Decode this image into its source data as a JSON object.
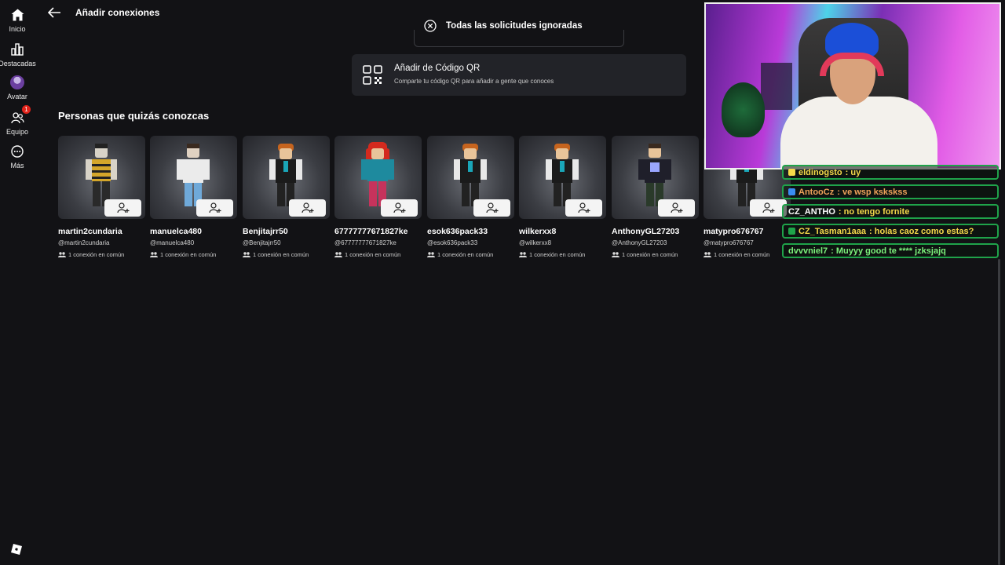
{
  "sidebar": {
    "items": [
      {
        "label": "Inicio",
        "icon": "home-icon"
      },
      {
        "label": "Destacadas",
        "icon": "charts-icon"
      },
      {
        "label": "Avatar",
        "icon": "avatar-icon"
      },
      {
        "label": "Equipo",
        "icon": "team-icon",
        "badge": "1"
      },
      {
        "label": "Más",
        "icon": "more-icon"
      }
    ]
  },
  "header": {
    "title": "Añadir conexiones"
  },
  "toast": {
    "text": "Todas las solicitudes ignoradas"
  },
  "qr": {
    "title": "Añadir de Código QR",
    "subtitle": "Comparte tu código QR para añadir a gente que conoces"
  },
  "section": {
    "title": "Personas que quizás conozcas"
  },
  "people": [
    {
      "name": "martin2cundaria",
      "handle": "@martin2cundaria",
      "connections": "1 conexión en común"
    },
    {
      "name": "manuelca480",
      "handle": "@manuelca480",
      "connections": "1 conexión en común"
    },
    {
      "name": "Benjitajrr50",
      "handle": "@Benjitajrr50",
      "connections": "1 conexión en común"
    },
    {
      "name": "67777777671827ke",
      "handle": "@67777777671827ke",
      "connections": "1 conexión en común"
    },
    {
      "name": "esok636pack33",
      "handle": "@esok636pack33",
      "connections": "1 conexión en común"
    },
    {
      "name": "wilkerxx8",
      "handle": "@wilkerxx8",
      "connections": "1 conexión en común"
    },
    {
      "name": "AnthonyGL27203",
      "handle": "@AnthonyGL27203",
      "connections": "1 conexión en común"
    },
    {
      "name": "matypro676767",
      "handle": "@matypro676767",
      "connections": "1 conexión en común"
    }
  ],
  "chat": [
    {
      "user": "eldinogsto",
      "message": "uy",
      "color": "#f5d94a"
    },
    {
      "user": "AntooCz",
      "message": "ve wsp kskskss",
      "color": "#f0a35a"
    },
    {
      "user": "CZ_ANTHO",
      "message": "no tengo fornite",
      "color": "#ffffff"
    },
    {
      "user": "CZ_Tasman1aaa",
      "message": "holas caoz como estas?",
      "color": "#f5d94a"
    },
    {
      "user": "dvvvniel7",
      "message": "Muyyy good te **** jzksjajq",
      "color": "#7cf27c"
    }
  ],
  "colors": {
    "background": "#121215",
    "card": "#222328",
    "chat_border": "#1fa34a",
    "badge": "#e2231a"
  }
}
